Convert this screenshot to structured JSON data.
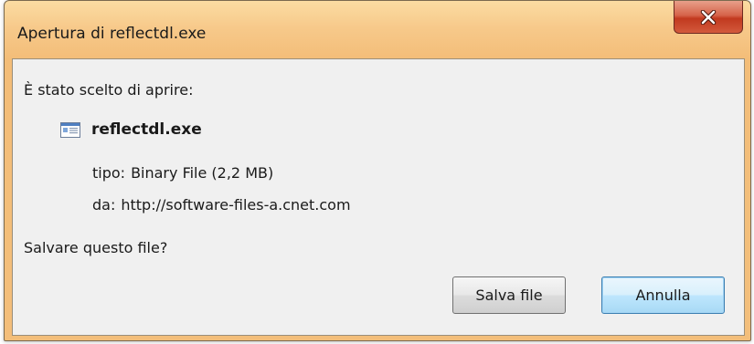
{
  "window": {
    "title": "Apertura di reflectdl.exe",
    "close_icon": "close-icon"
  },
  "dialog": {
    "prompt": "È stato scelto di aprire:",
    "file": {
      "icon": "executable-file-icon",
      "name": "reflectdl.exe"
    },
    "type_label": "tipo:",
    "type_value": "Binary File (2,2 MB)",
    "from_label": "da:",
    "from_value": "http://software-files-a.cnet.com",
    "question": "Salvare questo file?"
  },
  "buttons": {
    "save_label": "Salva file",
    "cancel_label": "Annulla"
  },
  "colors": {
    "title_bar": "#f7c98a",
    "close_button": "#c94a30",
    "client_background": "#f0f0f0",
    "default_button_border": "#3c7fb1"
  }
}
